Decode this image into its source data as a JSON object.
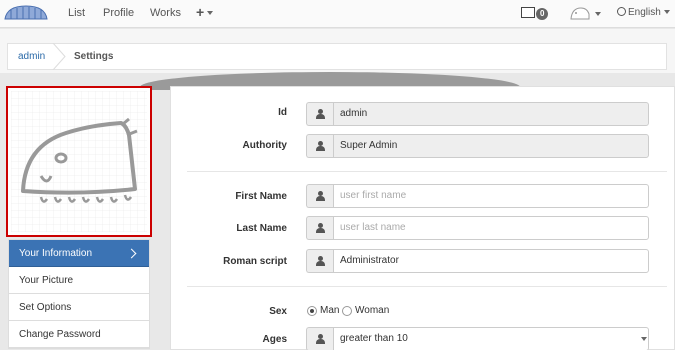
{
  "navbar": {
    "links": [
      "List",
      "Profile",
      "Works"
    ],
    "plus_label": "+",
    "mail_count": "0",
    "language": "English"
  },
  "breadcrumb": [
    "admin",
    "Settings"
  ],
  "sidebar": {
    "menu": [
      "Your Information",
      "Your Picture",
      "Set Options",
      "Change Password"
    ],
    "active_index": 0
  },
  "form": {
    "id": {
      "label": "Id",
      "value": "admin"
    },
    "authority": {
      "label": "Authority",
      "value": "Super Admin"
    },
    "first_name": {
      "label": "First Name",
      "placeholder": "user first name"
    },
    "last_name": {
      "label": "Last Name",
      "placeholder": "user last name"
    },
    "roman_script": {
      "label": "Roman script",
      "value": "Administrator"
    },
    "sex": {
      "label": "Sex",
      "options": [
        "Man",
        "Woman"
      ],
      "selected": "Man"
    },
    "ages": {
      "label": "Ages",
      "value": "greater than 10"
    }
  },
  "colors": {
    "active": "#3b73b4",
    "highlight_border": "#cc0000"
  }
}
